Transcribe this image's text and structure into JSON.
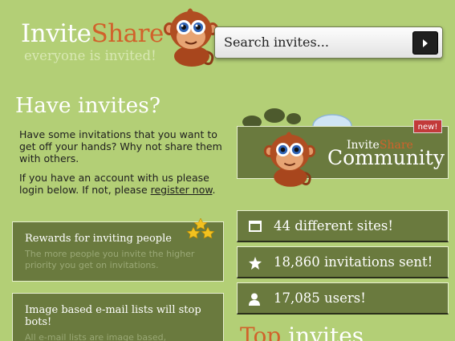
{
  "logo": {
    "part1": "Invite",
    "part2": "Share",
    "tagline": "everyone is invited!"
  },
  "search": {
    "placeholder": "Search invites..."
  },
  "left": {
    "heading": "Have invites?",
    "para1": "Have some invitations that you want to get off your hands? Why not share them with others.",
    "para2_before": "If you have an account with us please login below. If not, please ",
    "register_link": "register now",
    "para2_after": "."
  },
  "features": [
    {
      "title": "Rewards for inviting people",
      "text": "The more people you invite the higher priority you get on invitations."
    },
    {
      "title": "Image based e-mail lists will stop bots!",
      "text": "All e-mail lists are image based, preventing spam bot attacks!"
    }
  ],
  "community": {
    "badge": "new!",
    "sub1": "Invite",
    "sub2": "Share",
    "title": "Community"
  },
  "stats": [
    {
      "icon": "window-icon",
      "text": "44 different sites!"
    },
    {
      "icon": "star-icon",
      "text": "18,860 invitations sent!"
    },
    {
      "icon": "user-icon",
      "text": "17,085 users!"
    }
  ],
  "top_invites": {
    "word1": "Top",
    "word2": "invites"
  },
  "colors": {
    "background": "#b3cf76",
    "panel": "#6a7a3e",
    "accent": "#d1622b",
    "badge": "#c23a3a"
  }
}
